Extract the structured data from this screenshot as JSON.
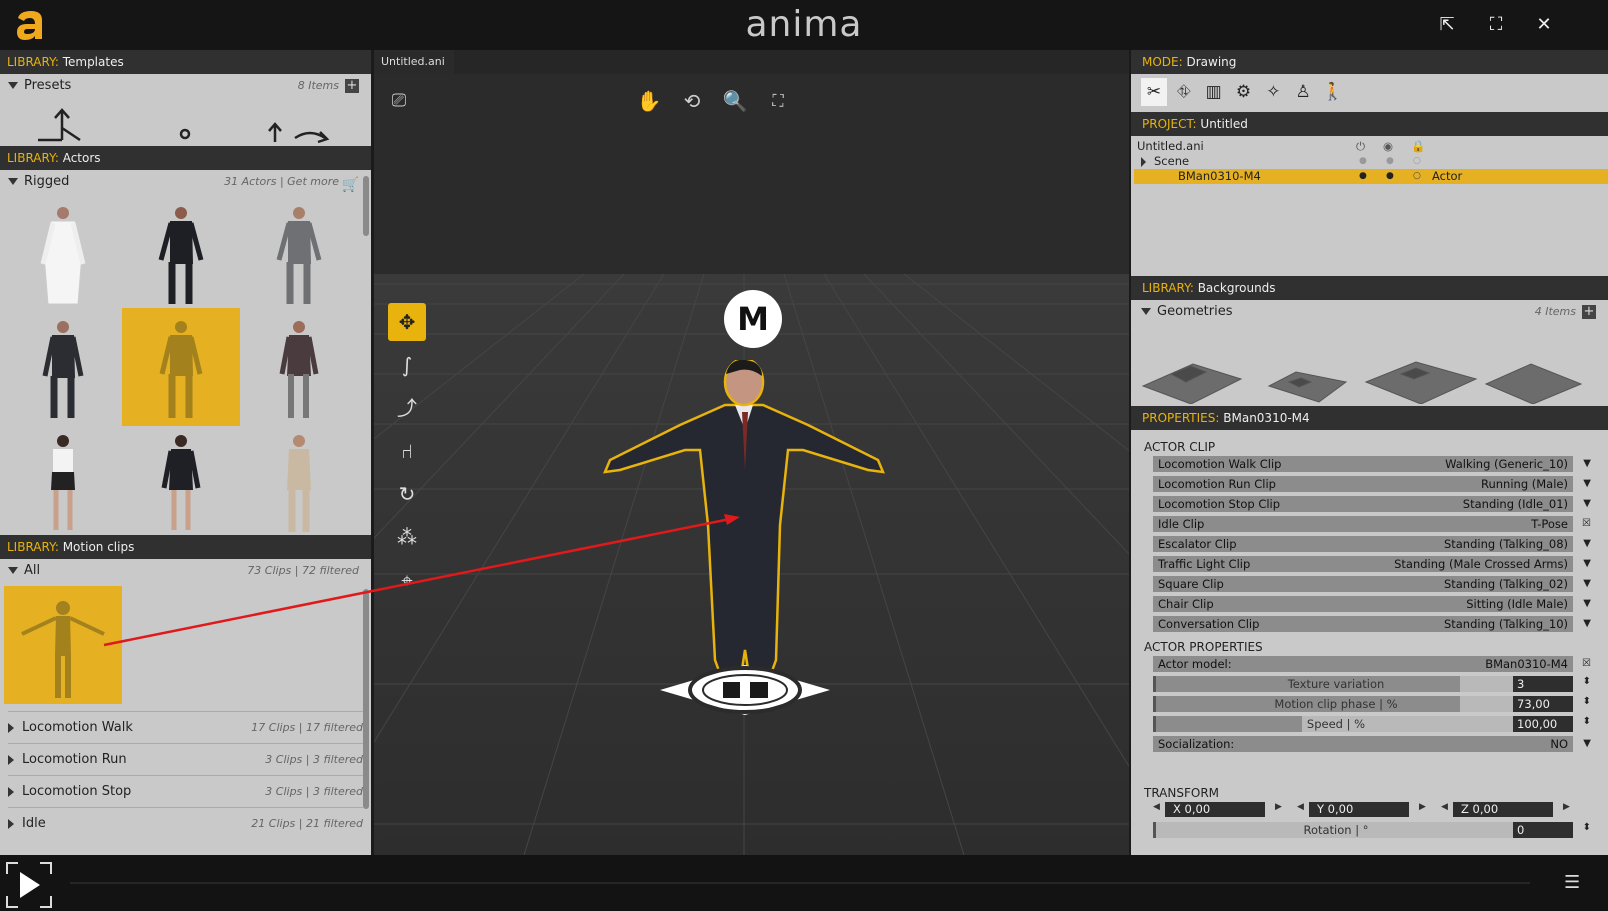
{
  "app": {
    "title": "anima"
  },
  "window_controls": {
    "popout": "⇱",
    "fullscreen": "⛶",
    "close": "✕"
  },
  "library_templates": {
    "prefix": "LIBRARY:",
    "name": "Templates",
    "section": "Presets",
    "count": "8 Items"
  },
  "library_actors": {
    "prefix": "LIBRARY:",
    "name": "Actors",
    "section": "Rigged",
    "count": "31 Actors | Get more"
  },
  "library_clips": {
    "prefix": "LIBRARY:",
    "name": "Motion clips",
    "section": "All",
    "count": "73 Clips | 72 filtered",
    "categories": [
      {
        "label": "Locomotion Walk",
        "count": "17 Clips | 17 filtered"
      },
      {
        "label": "Locomotion Run",
        "count": "3 Clips | 3 filtered"
      },
      {
        "label": "Locomotion Stop",
        "count": "3 Clips | 3 filtered"
      },
      {
        "label": "Idle",
        "count": "21 Clips | 21 filtered"
      }
    ]
  },
  "viewport": {
    "tab": "Untitled.ani",
    "marker_letter": "M"
  },
  "mode": {
    "prefix": "MODE:",
    "name": "Drawing"
  },
  "project": {
    "prefix": "PROJECT:",
    "name": "Untitled",
    "root": "Untitled.ani",
    "scene": "Scene",
    "selected_item": "BMan0310-M4",
    "selected_type": "Actor"
  },
  "library_backgrounds": {
    "prefix": "LIBRARY:",
    "name": "Backgrounds",
    "section": "Geometries",
    "count": "4 Items"
  },
  "properties": {
    "prefix": "PROPERTIES:",
    "name": "BMan0310-M4",
    "actor_clip_title": "ACTOR CLIP",
    "clips": [
      {
        "label": "Locomotion Walk Clip",
        "value": "Walking (Generic_10)"
      },
      {
        "label": "Locomotion Run Clip",
        "value": "Running (Male)"
      },
      {
        "label": "Locomotion Stop Clip",
        "value": "Standing (Idle_01)"
      },
      {
        "label": "Idle Clip",
        "value": "T-Pose"
      },
      {
        "label": "Escalator Clip",
        "value": "Standing (Talking_08)"
      },
      {
        "label": "Traffic Light Clip",
        "value": "Standing (Male Crossed Arms)"
      },
      {
        "label": "Square Clip",
        "value": "Standing (Talking_02)"
      },
      {
        "label": "Chair Clip",
        "value": "Sitting (Idle Male)"
      },
      {
        "label": "Conversation Clip",
        "value": "Standing (Talking_10)"
      }
    ],
    "actor_props_title": "ACTOR PROPERTIES",
    "actor_model_label": "Actor model:",
    "actor_model_value": "BMan0310-M4",
    "texture_label": "Texture variation",
    "texture_value": "3",
    "texture_fill": 0.73,
    "phase_label": "Motion clip phase | %",
    "phase_value": "73,00",
    "phase_fill": 0.73,
    "speed_label": "Speed | %",
    "speed_value": "100,00",
    "speed_fill": 0.35,
    "social_label": "Socialization:",
    "social_value": "NO",
    "transform_title": "TRANSFORM",
    "x": "X 0,00",
    "y": "Y 0,00",
    "z": "Z 0,00",
    "rotation_label": "Rotation | °",
    "rotation_value": "0"
  },
  "colors": {
    "accent": "#e8b30c",
    "selection": "#e5b022"
  }
}
